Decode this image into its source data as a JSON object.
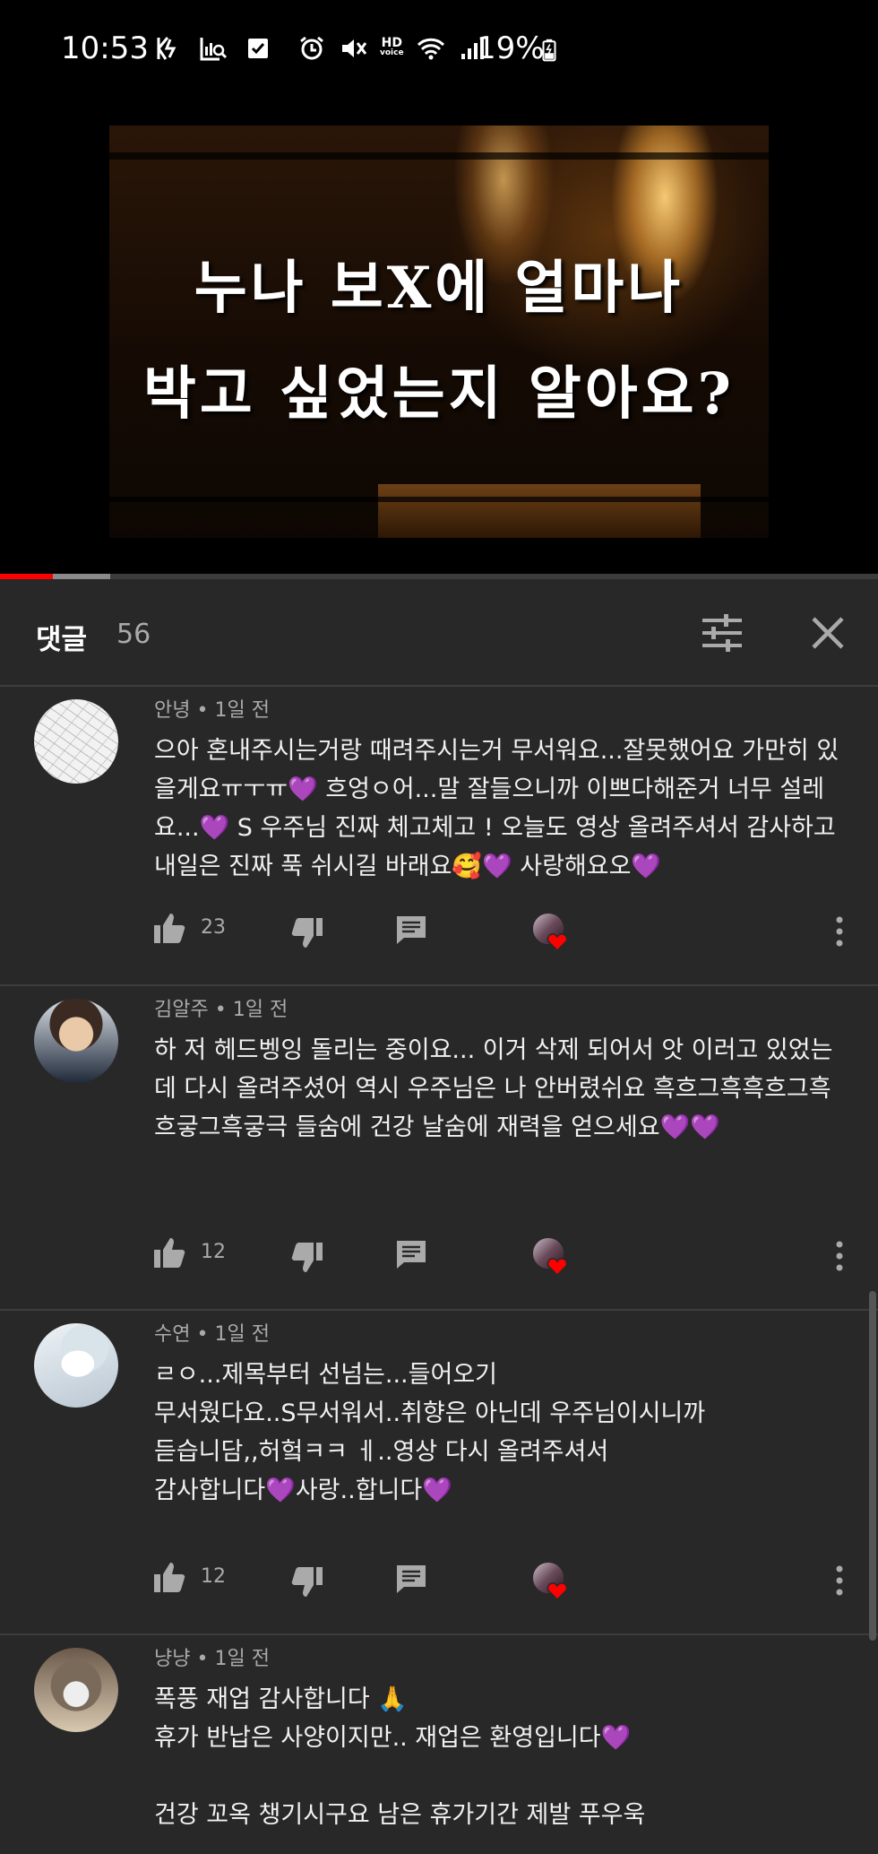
{
  "status_bar": {
    "time": "10:53",
    "battery": "19%",
    "hd_label_top": "HD",
    "hd_label_bottom": "voice"
  },
  "video": {
    "title_line_1": "누나 보X에 얼마나",
    "title_line_2": "박고 싶었는지 알아요?",
    "progress_played": 0.06,
    "progress_buffered": 0.125
  },
  "comments_panel": {
    "title": "댓글",
    "count": "56",
    "sort_icon": "sort-filter-icon",
    "close_icon": "close-icon"
  },
  "comments": [
    {
      "author": "안녕",
      "time": "1일 전",
      "text": "으아 혼내주시는거랑 때려주시는거 무서워요...잘못했어요 가만히 있을게요ㅠㅜㅠ💜 흐엉ㅇ어...말 잘들으니까 이쁘다해준거 너무 설레요...💜 S 우주님 진짜 체고체고 ! 오늘도 영상 올려주셔서 감사하고 내일은 진짜 푹 쉬시길 바래요🥰💜 사랑해요오💜",
      "likes": "23"
    },
    {
      "author": "김알주",
      "time": "1일 전",
      "text": "하 저 헤드벵잉 돌리는 중이요... 이거 삭제 되어서 앗 이러고 있었는데 다시 올려주셨어 역시 우주님은 나 안버렸쉬요 흑흐그흑흑흐그흑흐긓그흑긓극 들숨에 건강 날숨에 재력을 얻으세요💜💜",
      "likes": "12"
    },
    {
      "author": "수연",
      "time": "1일 전",
      "text": "ㄹㅇ...제목부터 선넘는...들어오기\n무서웠다요..S무서워서..취향은 아닌데 우주님이시니까\n듣습니담,,허헠ㅋㅋ ㅔ..영상 다시 올려주셔서\n감사합니다💜사랑..합니다💜",
      "likes": "12"
    },
    {
      "author": "냥냥",
      "time": "1일 전",
      "text": "폭풍 재업 감사합니다 🙏\n휴가 반납은 사양이지만..  재업은 환영입니다💜\n\n건강 꼬옥 챙기시구요 남은 휴가기간 제발 푸우욱",
      "likes": ""
    }
  ],
  "action_icons": {
    "like": "thumbs-up-icon",
    "dislike": "thumbs-down-icon",
    "reply": "reply-icon",
    "creator_heart": "creator-heart-icon",
    "more": "more-vert-icon"
  }
}
